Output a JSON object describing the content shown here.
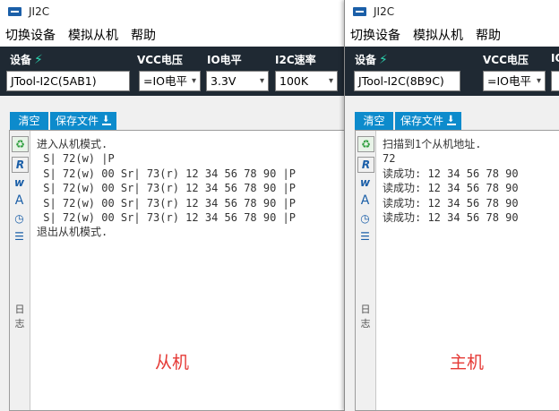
{
  "left": {
    "title": "JI2C",
    "menu": [
      "切换设备",
      "模拟从机",
      "帮助"
    ],
    "labels": {
      "device": "设备",
      "vcc": "VCC电压",
      "io": "IO电平",
      "speed": "I2C速率"
    },
    "device_value": "JTool-I2C(5AB1)",
    "vcc_value": "=IO电平",
    "io_value": "3.3V",
    "speed_value": "100K",
    "clear_label": "清空",
    "save_label": "保存文件",
    "side_label_1": "日",
    "side_label_2": "志",
    "log_lines": [
      "进入从机模式.",
      " S| 72(w) |P",
      " S| 72(w) 00 Sr| 73(r) 12 34 56 78 90 |P",
      " S| 72(w) 00 Sr| 73(r) 12 34 56 78 90 |P",
      " S| 72(w) 00 Sr| 73(r) 12 34 56 78 90 |P",
      " S| 72(w) 00 Sr| 73(r) 12 34 56 78 90 |P",
      "退出从机模式."
    ],
    "caption": "从机"
  },
  "right": {
    "title": "JI2C",
    "menu": [
      "切换设备",
      "模拟从机",
      "帮助"
    ],
    "labels": {
      "device": "设备",
      "vcc": "VCC电压",
      "io": "IO"
    },
    "device_value": "JTool-I2C(8B9C)",
    "vcc_value": "=IO电平",
    "clear_label": "清空",
    "save_label": "保存文件",
    "side_label_1": "日",
    "side_label_2": "志",
    "log_lines": [
      "扫描到1个从机地址.",
      "72",
      "读成功: 12 34 56 78 90",
      "读成功: 12 34 56 78 90",
      "读成功: 12 34 56 78 90",
      "读成功: 12 34 56 78 90"
    ],
    "caption": "主机"
  },
  "icons": [
    "recycle-icon",
    "r-icon",
    "w-icon",
    "font-a-icon",
    "clock-icon",
    "list-icon",
    "bolt-icon",
    "download-icon"
  ],
  "colors": {
    "header_bg": "#1f2933",
    "tab_blue": "#0d8bcc",
    "caption_red": "#e53935",
    "bolt_teal": "#2bd6b1"
  }
}
